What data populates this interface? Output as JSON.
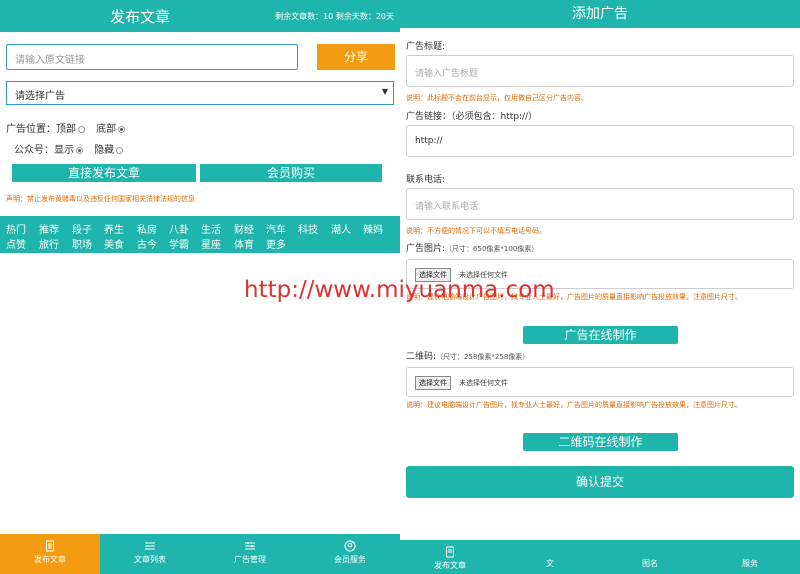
{
  "left": {
    "title": "发布文章",
    "stats": "剩余文章数：10 剩余天数：20天",
    "url_placeholder": "请输入原文链接",
    "share_label": "分享",
    "select_value": "请选择广告",
    "ad_position_label": "广告位置：",
    "ad_position_top": "顶部",
    "ad_position_bottom": "底部",
    "official_label": "公众号：",
    "official_show": "显示",
    "official_hide": "隐藏",
    "publish_label": "直接发布文章",
    "vip_label": "会员购买",
    "notice": "声明：禁止发布黄赌毒以及违反任何国家相关法律法规的信息",
    "categories_row1": [
      "热门",
      "推荐",
      "段子",
      "养生",
      "私房",
      "八卦",
      "生活",
      "财经",
      "汽车",
      "科技",
      "潮人",
      "辣妈"
    ],
    "categories_row2": [
      "点赞",
      "旅行",
      "职场",
      "美食",
      "古今",
      "学霸",
      "星座",
      "体育",
      "更多"
    ],
    "tabs": [
      "发布文章",
      "文章列表",
      "广告管理",
      "会员服务"
    ]
  },
  "right": {
    "title": "添加广告",
    "ad_title_label": "广告标题:",
    "ad_title_placeholder": "请输入广告标题",
    "ad_title_note": "说明：此标题不会在前台显示，仅用做自己区分广告内容。",
    "ad_link_label": "广告链接：（必须包含：http://）",
    "ad_link_value": "http://",
    "phone_label": "联系电话:",
    "phone_placeholder": "请输入联系电话",
    "phone_note": "说明：不方便的情况下可以不填写电话号码。",
    "ad_image_label": "广告图片:",
    "ad_image_size": "（尺寸：650像素*100像素）",
    "file_button": "选择文件",
    "file_text": "未选择任何文件",
    "ad_image_note": "说明：建议电脑端设计广告图片，找专业人士最好，广告图片的质量直接影响广告投放效果，注意图片尺寸。",
    "ad_make_label": "广告在线制作",
    "qr_label": "二维码:",
    "qr_size": "（尺寸：258像素*258像素）",
    "qr_note": "说明：建议电脑端设计广告图片，找专业人士最好，广告图片的质量直接影响广告投放效果，注意图片尺寸。",
    "qr_make_label": "二维码在线制作",
    "submit_label": "确认提交",
    "tabs": [
      "发布文章",
      "文",
      "图名",
      "服务"
    ]
  },
  "watermark": "http://www.miyuanma.com",
  "colors": {
    "teal": "#1fb5ad",
    "orange": "#f39c12",
    "note": "#e06a00"
  }
}
